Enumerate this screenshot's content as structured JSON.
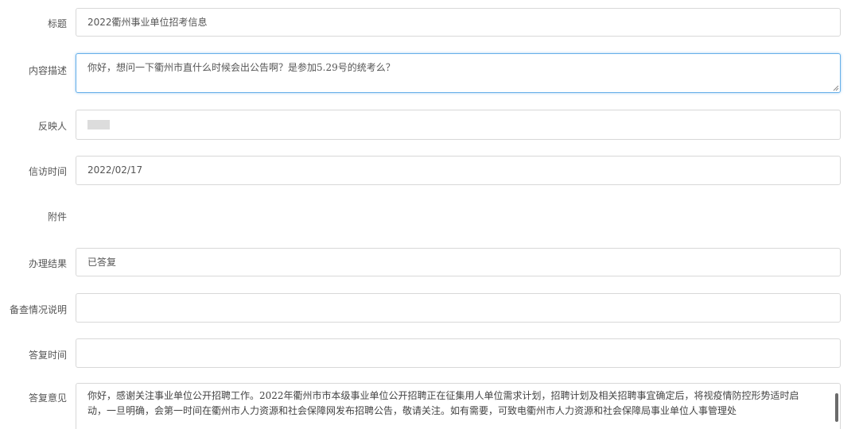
{
  "form": {
    "title": {
      "label": "标题",
      "value": "2022衢州事业单位招考信息"
    },
    "description": {
      "label": "内容描述",
      "value": "你好，想问一下衢州市直什么时候会出公告啊？是参加5.29号的统考么？"
    },
    "reporter": {
      "label": "反映人",
      "value": ""
    },
    "visit_time": {
      "label": "信访时间",
      "value": "2022/02/17"
    },
    "attachment": {
      "label": "附件"
    },
    "result": {
      "label": "办理结果",
      "value": "已答复"
    },
    "record_note": {
      "label": "备查情况说明",
      "value": ""
    },
    "reply_time": {
      "label": "答复时间",
      "value": ""
    },
    "reply_opinion": {
      "label": "答复意见",
      "value": "你好，感谢关注事业单位公开招聘工作。2022年衢州市市本级事业单位公开招聘正在征集用人单位需求计划，招聘计划及相关招聘事宜确定后，将视疫情防控形势适时启动，一旦明确，会第一时间在衢州市人力资源和社会保障网发布招聘公告，敬请关注。如有需要，可致电衢州市人力资源和社会保障局事业单位人事管理处"
    }
  }
}
